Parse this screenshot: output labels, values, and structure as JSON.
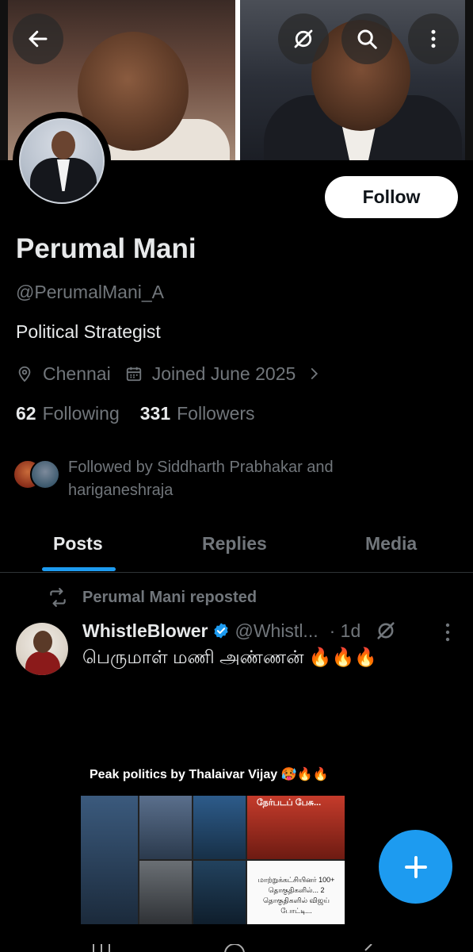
{
  "header": {
    "back_icon": "arrow-left-icon",
    "grok_icon": "grok-icon",
    "search_icon": "search-icon",
    "more_icon": "more-vertical-icon"
  },
  "profile": {
    "name": "Perumal Mani",
    "handle": "@PerumalMani_A",
    "bio": "Political Strategist",
    "location": "Chennai",
    "joined": "Joined June 2025",
    "following_count": "62",
    "following_label": "Following",
    "followers_count": "331",
    "followers_label": "Followers",
    "followed_by_text": "Followed by Siddharth Prabhakar and hariganeshraja",
    "follow_button": "Follow"
  },
  "tabs": [
    {
      "label": "Posts",
      "active": true
    },
    {
      "label": "Replies",
      "active": false
    },
    {
      "label": "Media",
      "active": false
    }
  ],
  "post": {
    "repost_label": "Perumal Mani reposted",
    "author": "WhistleBlower",
    "handle": "@Whistl...",
    "time": "· 1d",
    "text": "பெருமாள் மணி அண்ணன் 🔥🔥🔥",
    "embed_caption": "Peak politics by Thalaivar Vijay 🥵🔥🔥",
    "embed_tile_label": "நேர்படப் பேசு...",
    "embed_tile_text": "மாற்றுக்கட்சியினர் 100+ தொகுதிகளில்... 2 தொகுதிகளில் விஜய் போட்டி..."
  },
  "colors": {
    "accent": "#1d9bf0",
    "background": "#000000",
    "text_primary": "#e7e9ea",
    "text_secondary": "#71767b"
  }
}
